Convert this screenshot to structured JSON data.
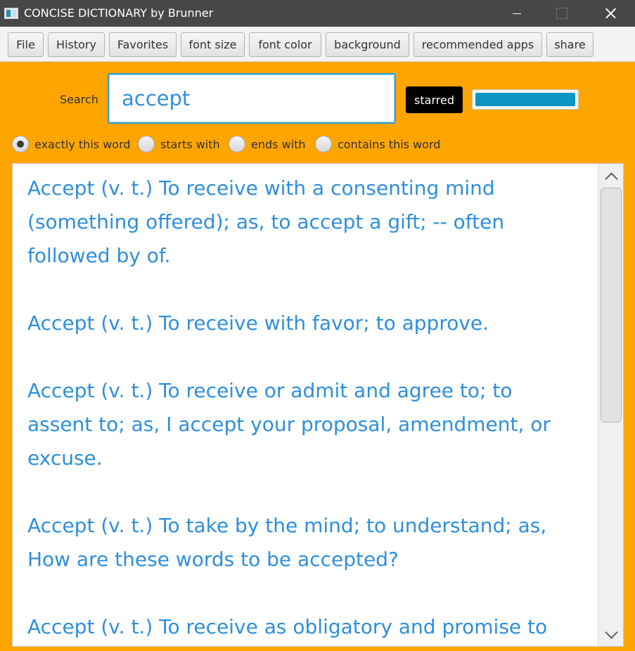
{
  "window": {
    "title": "CONCISE DICTIONARY by Brunner",
    "icon": "app-icon",
    "controls": [
      "minimize-icon",
      "maximize-icon",
      "close-icon"
    ]
  },
  "menu": {
    "file": "File",
    "history": "History",
    "favorites": "Favorites",
    "font_size": "font size",
    "font_color": "font color",
    "background": "background",
    "recommended_apps": "recommended apps",
    "share": "share"
  },
  "search": {
    "label": "Search",
    "value": "accept",
    "starred_label": "starred"
  },
  "match_modes": {
    "selected": "exactly this word",
    "options": [
      "exactly this word",
      "starts with",
      "ends with",
      "contains this word"
    ]
  },
  "definitions": [
    "Accept (v. t.) To receive with a consenting mind (something offered); as, to accept a gift; -- often followed by of.",
    "Accept (v. t.) To receive with favor; to approve.",
    "Accept (v. t.) To receive or admit and agree to; to assent to; as, I accept your proposal, amendment, or excuse.",
    "Accept (v. t.) To take by the mind; to understand; as, How are these words to be accepted?",
    "Accept (v. t.) To receive as obligatory and promise to"
  ],
  "colors": {
    "background": "#ffa500",
    "title_bar": "#474747",
    "definition_text": "#2e8fdc",
    "accent_bar": "#0c95c2",
    "starred_button": "#000000"
  }
}
